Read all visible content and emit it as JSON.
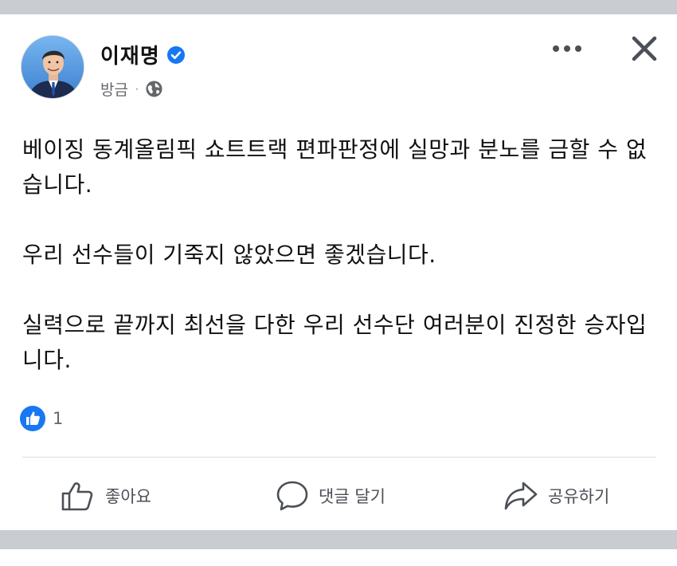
{
  "post": {
    "author": "이재명",
    "timestamp": "방금",
    "separator": "·",
    "paragraphs": [
      "베이징 동계올림픽 쇼트트랙 편파판정에 실망과 분노를 금할 수 없습니다.",
      "우리 선수들이 기죽지 않았으면 좋겠습니다.",
      "실력으로 끝까지 최선을 다한 우리 선수단 여러분이 진정한 승자입니다."
    ]
  },
  "reactions": {
    "count": "1"
  },
  "actions": {
    "like": "좋아요",
    "comment": "댓글 달기",
    "share": "공유하기"
  },
  "colors": {
    "verified": "#1877f2",
    "like_badge": "#1877f2",
    "text": "#111111",
    "muted": "#65676b",
    "band": "#c9ccd1"
  },
  "icons": [
    "verified-badge-icon",
    "globe-icon",
    "more-options-icon",
    "close-icon",
    "like-reaction-icon",
    "thumbs-up-icon",
    "comment-icon",
    "share-icon"
  ]
}
